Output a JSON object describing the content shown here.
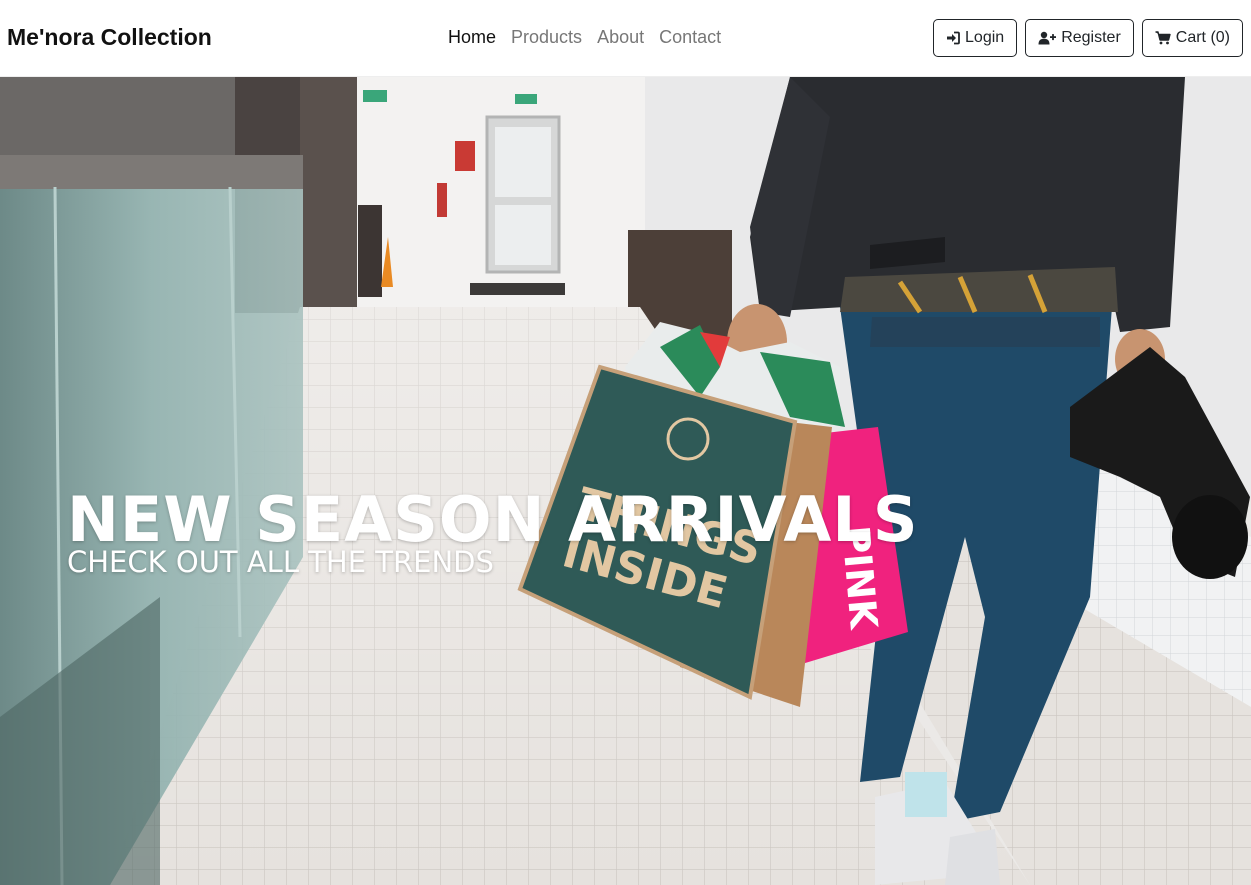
{
  "brand": {
    "name": "Me'nora Collection"
  },
  "nav": {
    "links": [
      {
        "label": "Home",
        "active": true
      },
      {
        "label": "Products",
        "active": false
      },
      {
        "label": "About",
        "active": false
      },
      {
        "label": "Contact",
        "active": false
      }
    ],
    "buttons": {
      "login": {
        "label": "Login",
        "icon": "sign-in-icon"
      },
      "register": {
        "label": "Register",
        "icon": "user-plus-icon"
      },
      "cart": {
        "label": "Cart (0)",
        "icon": "cart-icon"
      }
    }
  },
  "hero": {
    "title": "NEW SEASON ARRIVALS",
    "subtitle": "CHECK OUT ALL THE TRENDS",
    "image": "shopping-bags-hero-image"
  },
  "colors": {
    "text_dark": "#212529",
    "nav_muted": "#777777",
    "hero_text": "#ffffff",
    "bag_green": "#2f5a57",
    "bag_pink": "#f0227e",
    "bag_kraft": "#b9875a"
  }
}
